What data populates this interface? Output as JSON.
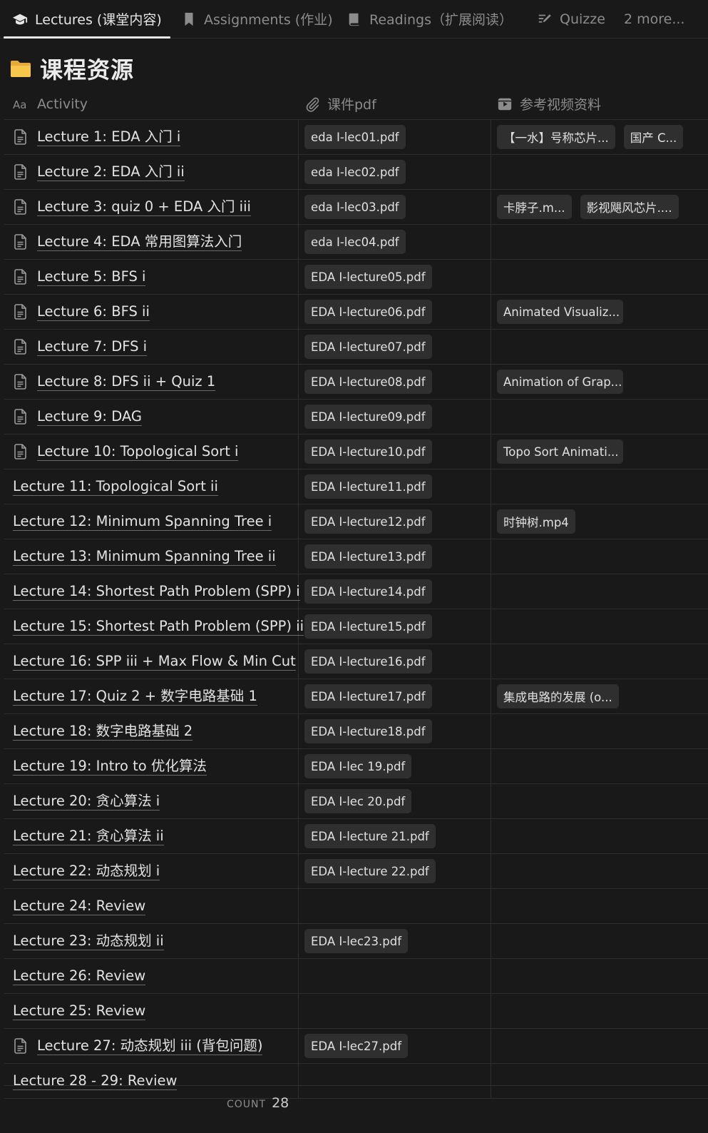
{
  "tabs": [
    {
      "label": "Lectures (课堂内容)",
      "icon": "graduation-cap-icon",
      "active": true
    },
    {
      "label": "Assignments (作业)",
      "icon": "bookmark-icon",
      "active": false
    },
    {
      "label": "Readings（扩展阅读）",
      "icon": "book-icon",
      "active": false
    },
    {
      "label": "Quizze",
      "icon": "edit-icon",
      "active": false
    },
    {
      "label": "2 more...",
      "icon": "",
      "active": false
    }
  ],
  "page": {
    "icon": "folder-icon",
    "title": "课程资源"
  },
  "table": {
    "columns": [
      {
        "label": "Activity",
        "icon": "text-aa-icon"
      },
      {
        "label": "课件pdf",
        "icon": "paperclip-icon"
      },
      {
        "label": "参考视频资料",
        "icon": "video-icon"
      }
    ],
    "rows": [
      {
        "title": "Lecture 1: EDA 入门 i",
        "page_icon": true,
        "pdf": "eda I-lec01.pdf",
        "videos": [
          "【一水】号称芯片...",
          "国产 C..."
        ]
      },
      {
        "title": "Lecture 2: EDA 入门 ii",
        "page_icon": true,
        "pdf": "eda I-lec02.pdf",
        "videos": []
      },
      {
        "title": "Lecture 3: quiz 0 + EDA 入门 iii",
        "page_icon": true,
        "pdf": "eda I-lec03.pdf",
        "videos": [
          "卡脖子.m...",
          "影视飓风芯片...."
        ]
      },
      {
        "title": "Lecture 4: EDA 常用图算法入门",
        "page_icon": true,
        "pdf": "eda I-lec04.pdf",
        "videos": []
      },
      {
        "title": "Lecture 5: BFS i",
        "page_icon": true,
        "pdf": "EDA I-lecture05.pdf",
        "videos": []
      },
      {
        "title": "Lecture 6: BFS ii",
        "page_icon": true,
        "pdf": "EDA I-lecture06.pdf",
        "videos": [
          "Animated Visualiz..."
        ]
      },
      {
        "title": "Lecture 7: DFS i",
        "page_icon": true,
        "pdf": "EDA I-lecture07.pdf",
        "videos": []
      },
      {
        "title": "Lecture 8: DFS ii + Quiz 1",
        "page_icon": true,
        "pdf": "EDA I-lecture08.pdf",
        "videos": [
          "Animation of Grap..."
        ]
      },
      {
        "title": "Lecture 9: DAG",
        "page_icon": true,
        "pdf": "EDA I-lecture09.pdf",
        "videos": []
      },
      {
        "title": "Lecture 10: Topological Sort i",
        "page_icon": true,
        "pdf": "EDA I-lecture10.pdf",
        "videos": [
          "Topo Sort Animati..."
        ]
      },
      {
        "title": "Lecture 11: Topological Sort ii",
        "page_icon": false,
        "pdf": "EDA I-lecture11.pdf",
        "videos": []
      },
      {
        "title": "Lecture 12: Minimum Spanning Tree i",
        "page_icon": false,
        "pdf": "EDA I-lecture12.pdf",
        "videos": [
          "时钟树.mp4"
        ]
      },
      {
        "title": "Lecture 13: Minimum Spanning Tree ii",
        "page_icon": false,
        "pdf": "EDA I-lecture13.pdf",
        "videos": []
      },
      {
        "title": "Lecture 14: Shortest Path Problem (SPP) i",
        "page_icon": false,
        "pdf": "EDA I-lecture14.pdf",
        "videos": []
      },
      {
        "title": "Lecture 15: Shortest Path Problem (SPP) ii",
        "page_icon": false,
        "pdf": "EDA I-lecture15.pdf",
        "videos": []
      },
      {
        "title": "Lecture 16: SPP iii + Max Flow & Min Cut",
        "page_icon": false,
        "pdf": "EDA I-lecture16.pdf",
        "videos": []
      },
      {
        "title": "Lecture 17: Quiz 2 + 数字电路基础 1",
        "page_icon": false,
        "pdf": "EDA I-lecture17.pdf",
        "videos": [
          "集成电路的发展 (o..."
        ]
      },
      {
        "title": "Lecture 18: 数字电路基础 2",
        "page_icon": false,
        "pdf": "EDA I-lecture18.pdf",
        "videos": []
      },
      {
        "title": "Lecture 19: Intro to 优化算法",
        "page_icon": false,
        "pdf": "EDA I-lec 19.pdf",
        "videos": []
      },
      {
        "title": "Lecture 20: 贪心算法 i",
        "page_icon": false,
        "pdf": "EDA I-lec 20.pdf",
        "videos": []
      },
      {
        "title": "Lecture 21: 贪心算法 ii",
        "page_icon": false,
        "pdf": "EDA I-lecture 21.pdf",
        "videos": []
      },
      {
        "title": "Lecture 22: 动态规划 i",
        "page_icon": false,
        "pdf": "EDA I-lecture 22.pdf",
        "videos": []
      },
      {
        "title": "Lecture 24: Review",
        "page_icon": false,
        "pdf": "",
        "videos": []
      },
      {
        "title": "Lecture 23: 动态规划 ii",
        "page_icon": false,
        "pdf": "EDA I-lec23.pdf",
        "videos": []
      },
      {
        "title": "Lecture 26: Review",
        "page_icon": false,
        "pdf": "",
        "videos": []
      },
      {
        "title": "Lecture 25: Review",
        "page_icon": false,
        "pdf": "",
        "videos": []
      },
      {
        "title": "Lecture 27: 动态规划 iii (背包问题)",
        "page_icon": true,
        "pdf": "EDA I-lec27.pdf",
        "videos": []
      },
      {
        "title": "Lecture 28 - 29: Review",
        "page_icon": false,
        "pdf": "",
        "videos": []
      }
    ]
  },
  "footer": {
    "count_label": "COUNT",
    "count_value": "28"
  }
}
